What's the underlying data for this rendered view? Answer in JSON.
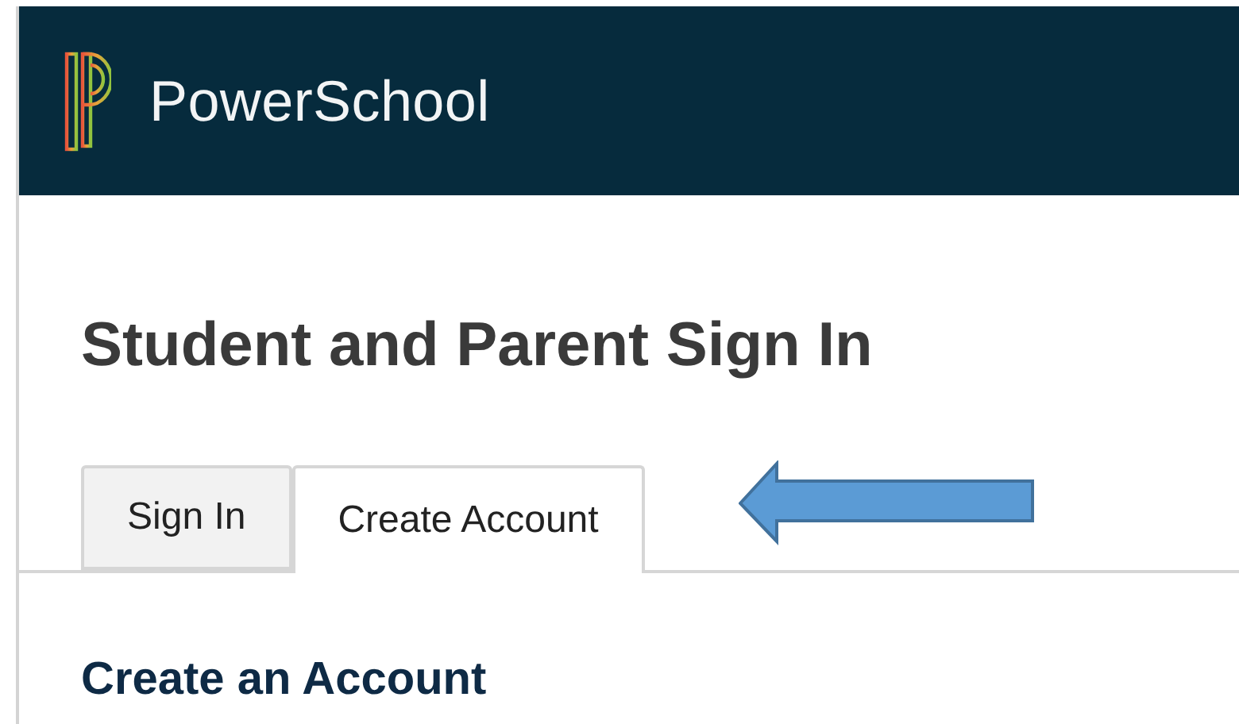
{
  "header": {
    "brand": "PowerSchool"
  },
  "title": "Student and Parent Sign In",
  "tabs": [
    {
      "label": "Sign In",
      "selected": false
    },
    {
      "label": "Create Account",
      "selected": true
    }
  ],
  "section_title": "Create an Account"
}
